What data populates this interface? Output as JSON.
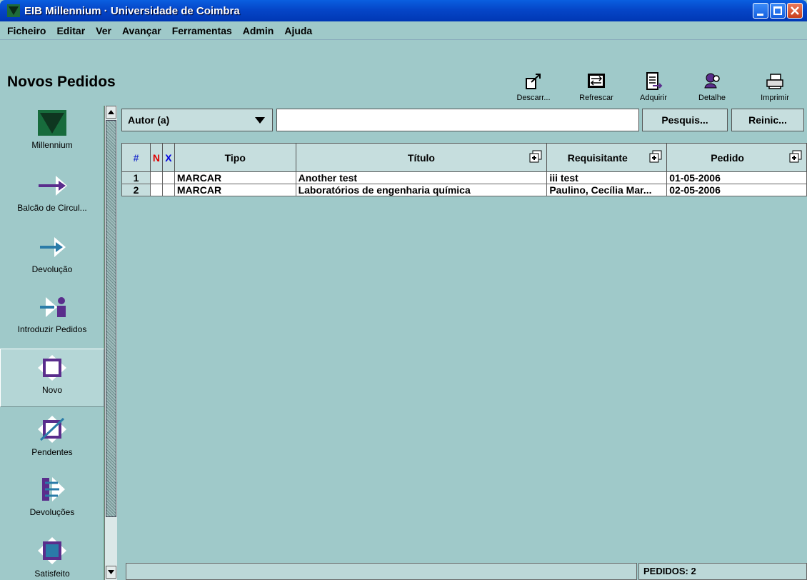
{
  "window": {
    "title": "EIB Millennium · Universidade de Coimbra"
  },
  "menu": [
    "Ficheiro",
    "Editar",
    "Ver",
    "Avançar",
    "Ferramentas",
    "Admin",
    "Ajuda"
  ],
  "page_title": "Novos Pedidos",
  "toolbar": [
    {
      "label": "Descarr...",
      "icon": "discard-icon"
    },
    {
      "label": "Refrescar",
      "icon": "refresh-icon"
    },
    {
      "label": "Adquirir",
      "icon": "acquire-icon"
    },
    {
      "label": "Detalhe",
      "icon": "detail-icon"
    },
    {
      "label": "Imprimir",
      "icon": "printer-icon"
    }
  ],
  "sidebar": [
    {
      "label": "Millennium",
      "icon": "millennium-logo-icon"
    },
    {
      "label": "Balcão de Circul...",
      "icon": "circulation-arrow-icon"
    },
    {
      "label": "Devolução",
      "icon": "return-arrow-icon"
    },
    {
      "label": "Introduzir Pedidos",
      "icon": "enter-request-icon"
    },
    {
      "label": "Novo",
      "icon": "new-square-icon",
      "active": true
    },
    {
      "label": "Pendentes",
      "icon": "pending-icon"
    },
    {
      "label": "Devoluções",
      "icon": "returns-icon"
    },
    {
      "label": "Satisfeito",
      "icon": "satisfied-icon"
    }
  ],
  "search": {
    "field": "Autor (a)",
    "query": "",
    "search_button": "Pesquis...",
    "reset_button": "Reinic..."
  },
  "table": {
    "headers": {
      "num": "#",
      "n": "N",
      "x": "X",
      "tipo": "Tipo",
      "titulo": "Título",
      "requisitante": "Requisitante",
      "pedido": "Pedido"
    },
    "rows": [
      {
        "num": "1",
        "n": "",
        "x": "",
        "tipo": "MARCAR",
        "titulo": "Another test",
        "requisitante": "iii test",
        "pedido": "01-05-2006"
      },
      {
        "num": "2",
        "n": "",
        "x": "",
        "tipo": "MARCAR",
        "titulo": "Laboratórios de engenharia química",
        "requisitante": "Paulino, Cecília Mar...",
        "pedido": "02-05-2006"
      }
    ]
  },
  "status": {
    "message": "",
    "count": "PEDIDOS: 2"
  },
  "colors": {
    "background": "#9fc9c9",
    "title_bar": "#0546c8",
    "n_header": "#e00000",
    "x_header": "#0000e0"
  }
}
